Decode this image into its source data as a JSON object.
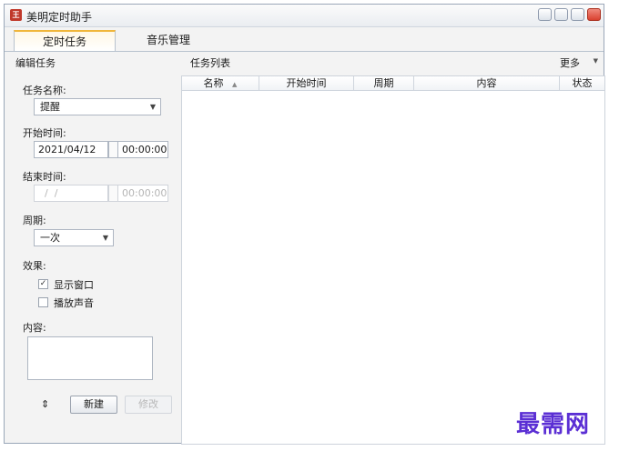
{
  "window": {
    "title": "美明定时助手",
    "app_icon_glyph": "王"
  },
  "tabs": [
    {
      "label": "定时任务",
      "active": true
    },
    {
      "label": "音乐管理",
      "active": false
    }
  ],
  "editor": {
    "header": "编辑任务",
    "task_name_label": "任务名称:",
    "task_name_value": "提醒",
    "start_label": "开始时间:",
    "start_date": "2021/04/12",
    "start_time": "00:00:00",
    "end_label": "结束时间:",
    "end_date": "  /  /",
    "end_time": "00:00:00",
    "period_label": "周期:",
    "period_value": "一次",
    "effect_label": "效果:",
    "show_window_label": "显示窗口",
    "show_window_checked": true,
    "check_mark": "✓",
    "play_sound_label": "播放声音",
    "play_sound_checked": false,
    "content_label": "内容:",
    "refresh_icon_glyph": "⇕",
    "new_button": "新建",
    "modify_button": "修改"
  },
  "task_list": {
    "header": "任务列表",
    "more_label": "更多",
    "more_arrow": "▼",
    "columns": [
      "名称",
      "开始时间",
      "周期",
      "内容",
      "状态"
    ],
    "sort_indicator": "▲"
  },
  "dropdown_arrow": "▼",
  "watermark": "最需网"
}
